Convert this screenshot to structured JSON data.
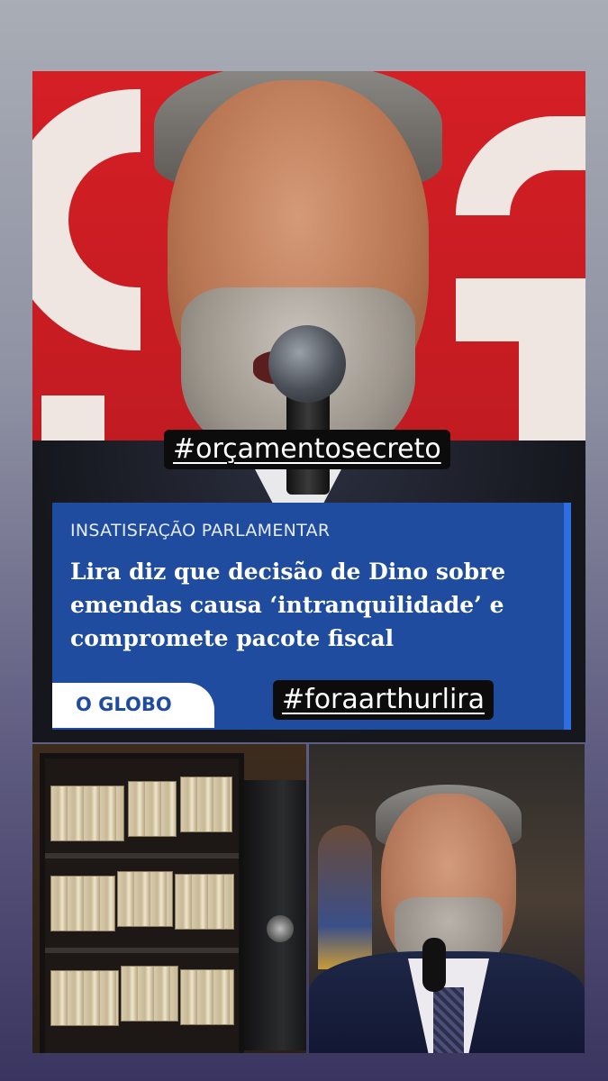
{
  "hashtags": {
    "top": "#orçamentosecreto",
    "bottom": "#foraarthurlira"
  },
  "news_card": {
    "kicker": "INSATISFAÇÃO PARLAMENTAR",
    "headline": "Lira diz que decisão de Dino sobre emendas causa ‘intranquilidade’ e compromete pacote fiscal",
    "source_logo": "O GLOBO",
    "colors": {
      "background": "#1f4c9f",
      "accent": "#2d6fe0"
    }
  },
  "images": {
    "top": "speaker-at-microphone-photo",
    "bottom_left": "safe-with-cash-photo",
    "bottom_right": "man-at-microphone-photo"
  }
}
